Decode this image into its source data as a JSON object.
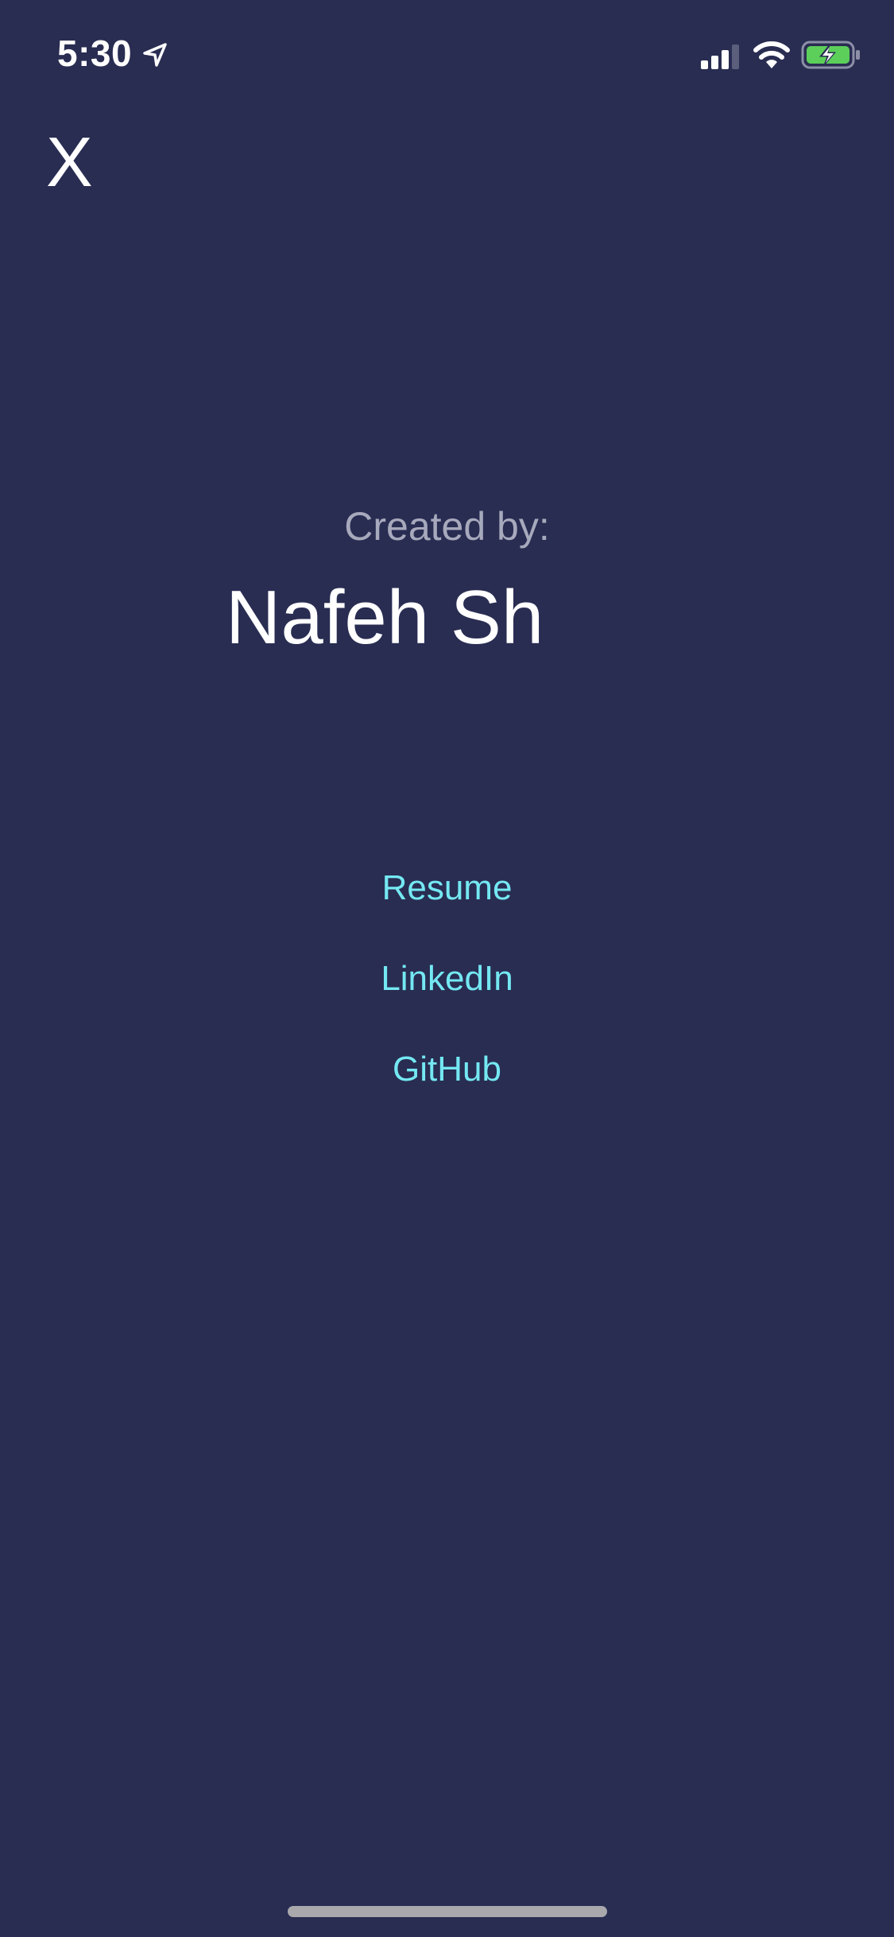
{
  "status_bar": {
    "time": "5:30",
    "icons": [
      "location-arrow-icon",
      "cellular-signal-icon",
      "wifi-icon",
      "battery-charging-icon"
    ],
    "battery_color": "#5ccf5a"
  },
  "header": {
    "close_label": "X"
  },
  "credits": {
    "created_by_label": "Created by:",
    "author_name": "Nafeh Sh"
  },
  "links": {
    "resume": "Resume",
    "linkedin": "LinkedIn",
    "github": "GitHub"
  },
  "colors": {
    "background": "#292d52",
    "link": "#74e8f2",
    "secondary_text": "#a7a9bc",
    "primary_text": "#ffffff"
  }
}
